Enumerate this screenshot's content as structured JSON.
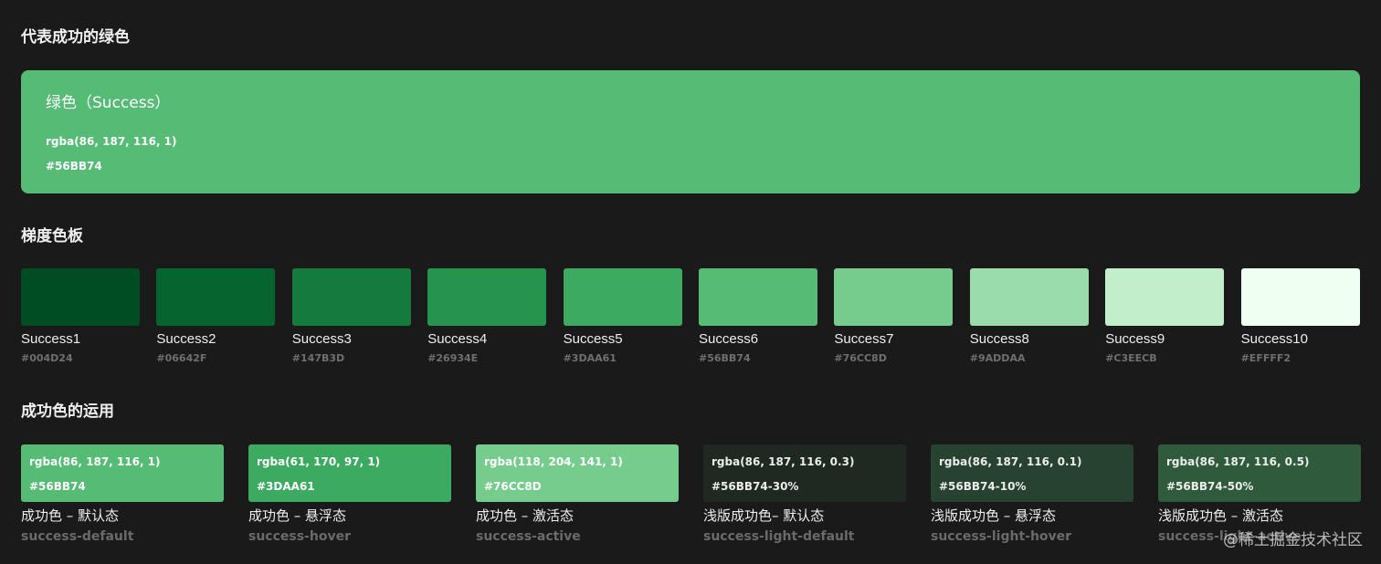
{
  "headings": {
    "main": "代表成功的绿色",
    "palette": "梯度色板",
    "usage": "成功色的运用"
  },
  "hero": {
    "title": "绿色（Success）",
    "rgba": "rgba(86, 187, 116, 1)",
    "hex": "#56BB74",
    "color": "#56BB74"
  },
  "palette": [
    {
      "name": "Success1",
      "hex": "#004D24",
      "color": "#004D24"
    },
    {
      "name": "Success2",
      "hex": "#06642F",
      "color": "#06642F"
    },
    {
      "name": "Success3",
      "hex": "#147B3D",
      "color": "#147B3D"
    },
    {
      "name": "Success4",
      "hex": "#26934E",
      "color": "#26934E"
    },
    {
      "name": "Success5",
      "hex": "#3DAA61",
      "color": "#3DAA61"
    },
    {
      "name": "Success6",
      "hex": "#56BB74",
      "color": "#56BB74"
    },
    {
      "name": "Success7",
      "hex": "#76CC8D",
      "color": "#76CC8D"
    },
    {
      "name": "Success8",
      "hex": "#9ADDAA",
      "color": "#9ADDAA"
    },
    {
      "name": "Success9",
      "hex": "#C3EECB",
      "color": "#C3EECB"
    },
    {
      "name": "Success10",
      "hex": "#EFFFF2",
      "color": "#EFFFF2"
    }
  ],
  "usage": [
    {
      "rgba": "rgba(86, 187, 116, 1)",
      "hex": "#56BB74",
      "label": "成功色 – 默认态",
      "token": "success-default",
      "bg": "#56BB74",
      "text_color": "#ffffff"
    },
    {
      "rgba": "rgba(61, 170, 97, 1)",
      "hex": "#3DAA61",
      "label": "成功色 – 悬浮态",
      "token": "success-hover",
      "bg": "#3DAA61",
      "text_color": "#ffffff"
    },
    {
      "rgba": "rgba(118, 204, 141, 1)",
      "hex": "#76CC8D",
      "label": "成功色 – 激活态",
      "token": "success-active",
      "bg": "#76CC8D",
      "text_color": "#ffffff"
    },
    {
      "rgba": "rgba(86, 187, 116, 0.3)",
      "hex": "#56BB74-30%",
      "label": "浅版成功色– 默认态",
      "token": "success-light-default",
      "bg": "#1e2a21",
      "text_color": "#ececec"
    },
    {
      "rgba": "rgba(86, 187, 116, 0.1)",
      "hex": "#56BB74-10%",
      "label": "浅版成功色 – 悬浮态",
      "token": "success-light-hover",
      "bg": "#27432f",
      "text_color": "#ececec"
    },
    {
      "rgba": "rgba(86, 187, 116, 0.5)",
      "hex": "#56BB74-50%",
      "label": "浅版成功色 – 激活态",
      "token": "success-light-active",
      "bg": "#2f5b3c",
      "text_color": "#ececec"
    }
  ],
  "watermark": "@稀土掘金技术社区"
}
